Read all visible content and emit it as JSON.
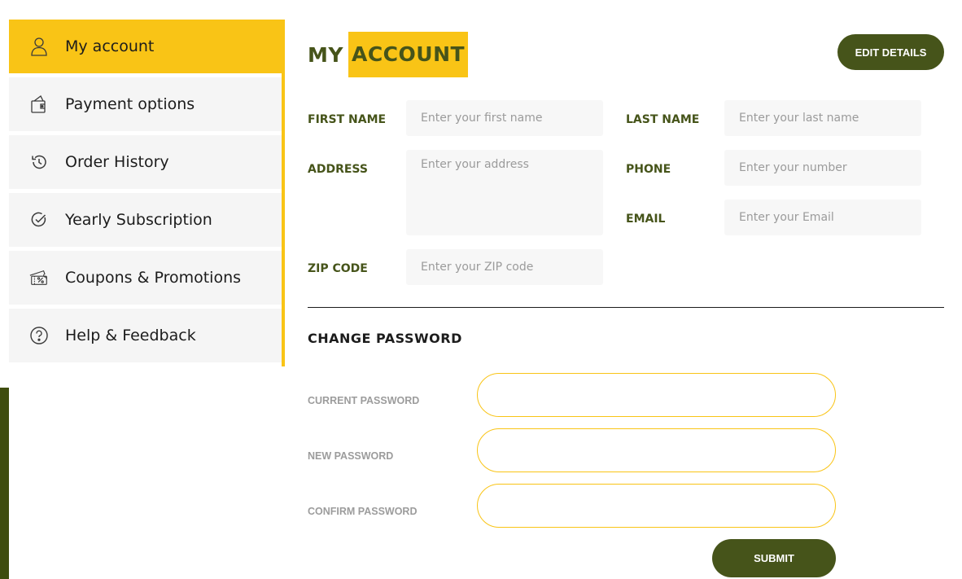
{
  "sidebar": {
    "items": [
      {
        "label": "My account",
        "icon": "user-icon",
        "active": true
      },
      {
        "label": "Payment options",
        "icon": "wallet-icon",
        "active": false
      },
      {
        "label": "Order History",
        "icon": "history-icon",
        "active": false
      },
      {
        "label": "Yearly Subscription",
        "icon": "check-circle-icon",
        "active": false
      },
      {
        "label": "Coupons & Promotions",
        "icon": "coupon-icon",
        "active": false
      },
      {
        "label": "Help & Feedback",
        "icon": "help-circle-icon",
        "active": false
      }
    ]
  },
  "header": {
    "title_word1": "MY",
    "title_word2": "ACCOUNT",
    "edit_label": "EDIT DETAILS"
  },
  "form": {
    "first_name": {
      "label": "FIRST NAME",
      "placeholder": "Enter your first name",
      "value": ""
    },
    "last_name": {
      "label": "LAST NAME",
      "placeholder": "Enter your last name",
      "value": ""
    },
    "address": {
      "label": "ADDRESS",
      "placeholder": "Enter your address",
      "value": ""
    },
    "phone": {
      "label": "PHONE",
      "placeholder": "Enter your number",
      "value": ""
    },
    "email": {
      "label": "EMAIL",
      "placeholder": "Enter your Email",
      "value": ""
    },
    "zip": {
      "label": "ZIP CODE",
      "placeholder": "Enter your ZIP code",
      "value": ""
    }
  },
  "password": {
    "title": "CHANGE PASSWORD",
    "current_label": "CURRENT PASSWORD",
    "new_label": "NEW PASSWORD",
    "confirm_label": "CONFIRM PASSWORD",
    "submit_label": "SUBMIT"
  },
  "colors": {
    "accent": "#f9c416",
    "brand_dark": "#46541a",
    "footer_band": "#3f4d0f",
    "field_bg": "#f7f7f7",
    "sidebar_item_bg": "#f5f5f5"
  }
}
